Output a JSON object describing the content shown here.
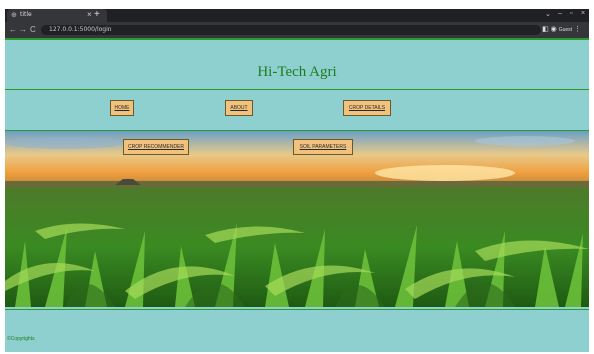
{
  "browser": {
    "tab_title": "title",
    "address": "127.0.0.1:5000/login",
    "new_tab_symbol": "+",
    "close_symbol": "×",
    "profile_label": "Guest"
  },
  "site": {
    "title": "Hi-Tech Agri",
    "nav": {
      "home": "HOME",
      "about": "ABOUT",
      "crop_details": "CROP DETAILS"
    },
    "hero": {
      "crop_recommender": "CROP RECOMMENDER",
      "soil_parameters": "SOIL PARAMETERS"
    },
    "footer": {
      "copyright": "©Copyrights"
    }
  },
  "colors": {
    "page_bg": "#8ecfcf",
    "accent_green": "#1e7e1e",
    "button_bg": "#f1c27d"
  }
}
